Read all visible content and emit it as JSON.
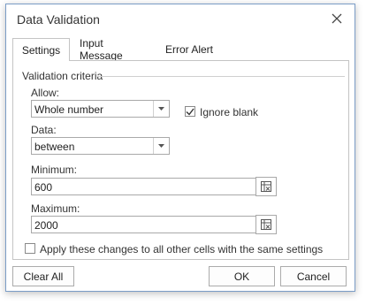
{
  "dialog": {
    "title": "Data Validation"
  },
  "tabs": [
    {
      "label": "Settings",
      "active": true
    },
    {
      "label": "Input Message",
      "active": false
    },
    {
      "label": "Error Alert",
      "active": false
    }
  ],
  "settings": {
    "group_label": "Validation criteria",
    "allow_label": "Allow:",
    "allow_value": "Whole number",
    "ignore_blank_label": "Ignore blank",
    "ignore_blank_checked": true,
    "data_label": "Data:",
    "data_value": "between",
    "minimum_label": "Minimum:",
    "minimum_value": "600",
    "maximum_label": "Maximum:",
    "maximum_value": "2000",
    "apply_all_label": "Apply these changes to all other cells with the same settings",
    "apply_all_checked": false
  },
  "buttons": {
    "clear_all": "Clear All",
    "ok": "OK",
    "cancel": "Cancel"
  },
  "icons": {
    "close": "close-icon",
    "dropdown": "chevron-down-icon",
    "picker": "range-picker-icon",
    "check": "checkmark-icon"
  },
  "colors": {
    "border": "#7a9cc6",
    "control_border": "#a9a9a9"
  }
}
